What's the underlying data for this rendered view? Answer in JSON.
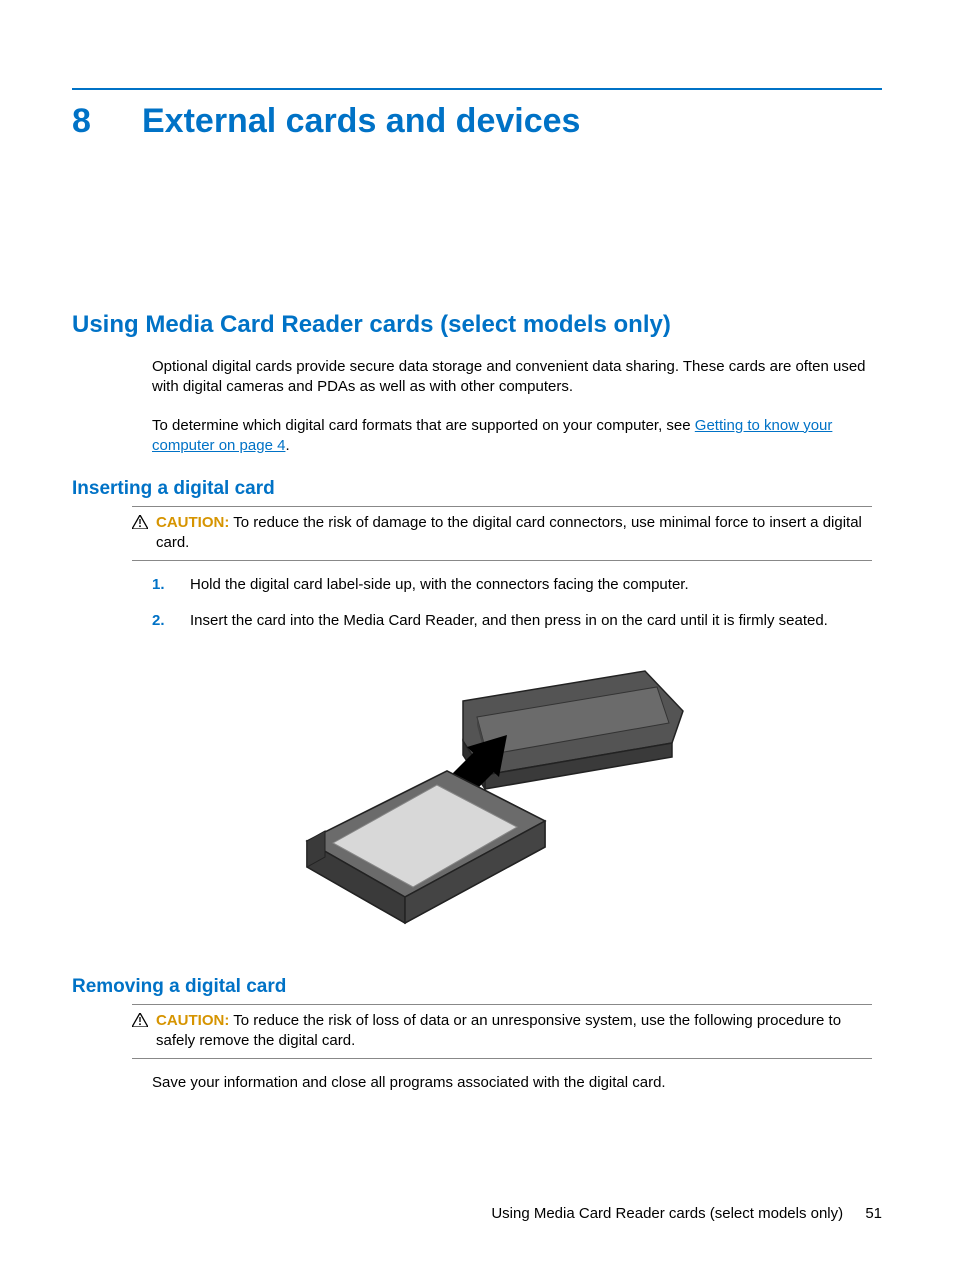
{
  "chapter": {
    "number": "8",
    "title": "External cards and devices"
  },
  "section": {
    "title": "Using Media Card Reader cards (select models only)",
    "para1": "Optional digital cards provide secure data storage and convenient data sharing. These cards are often used with digital cameras and PDAs as well as with other computers.",
    "para2_pre": "To determine which digital card formats that are supported on your computer, see ",
    "para2_link": "Getting to know your computer on page 4",
    "para2_post": "."
  },
  "inserting": {
    "title": "Inserting a digital card",
    "caution_label": "CAUTION:",
    "caution_text": "To reduce the risk of damage to the digital card connectors, use minimal force to insert a digital card.",
    "steps": [
      {
        "num": "1.",
        "text": "Hold the digital card label-side up, with the connectors facing the computer."
      },
      {
        "num": "2.",
        "text": "Insert the card into the Media Card Reader, and then press in on the card until it is firmly seated."
      }
    ]
  },
  "removing": {
    "title": "Removing a digital card",
    "caution_label": "CAUTION:",
    "caution_text": "To reduce the risk of loss of data or an unresponsive system, use the following procedure to safely remove the digital card.",
    "para": "Save your information and close all programs associated with the digital card."
  },
  "footer": {
    "text": "Using Media Card Reader cards (select models only)",
    "page": "51"
  }
}
